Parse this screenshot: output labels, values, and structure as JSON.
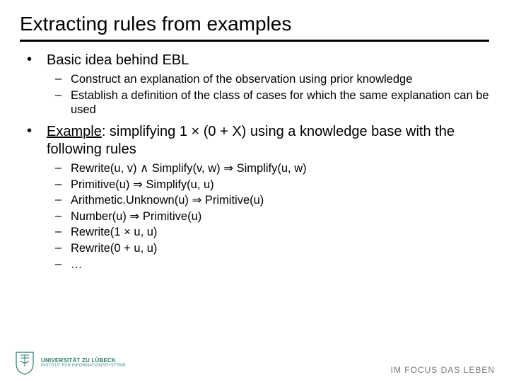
{
  "title": "Extracting rules from examples",
  "bullets": [
    {
      "label_prefix": "",
      "label_underlined": "",
      "label_suffix": "Basic idea behind EBL",
      "sub": [
        "Construct an explanation of the observation using prior knowledge",
        "Establish a definition of the class of cases for which the same explanation can be used"
      ]
    },
    {
      "label_prefix": "",
      "label_underlined": "Example",
      "label_suffix": ": simplifying 1 × (0 + X) using a knowledge base with the following rules",
      "sub": [
        "Rewrite(u, v) ∧ Simplify(v, w) ⇒ Simplify(u, w)",
        "Primitive(u) ⇒ Simplify(u, u)",
        "Arithmetic.Unknown(u) ⇒ Primitive(u)",
        "Number(u) ⇒ Primitive(u)",
        "Rewrite(1 × u, u)",
        "Rewrite(0 + u, u)",
        "…"
      ]
    }
  ],
  "footer": {
    "uni_line1": "UNIVERSITÄT ZU LÜBECK",
    "uni_line2": "INSTITUT FÜR INFORMATIONSSYSTEME",
    "tagline": "IM FOCUS DAS LEBEN"
  }
}
